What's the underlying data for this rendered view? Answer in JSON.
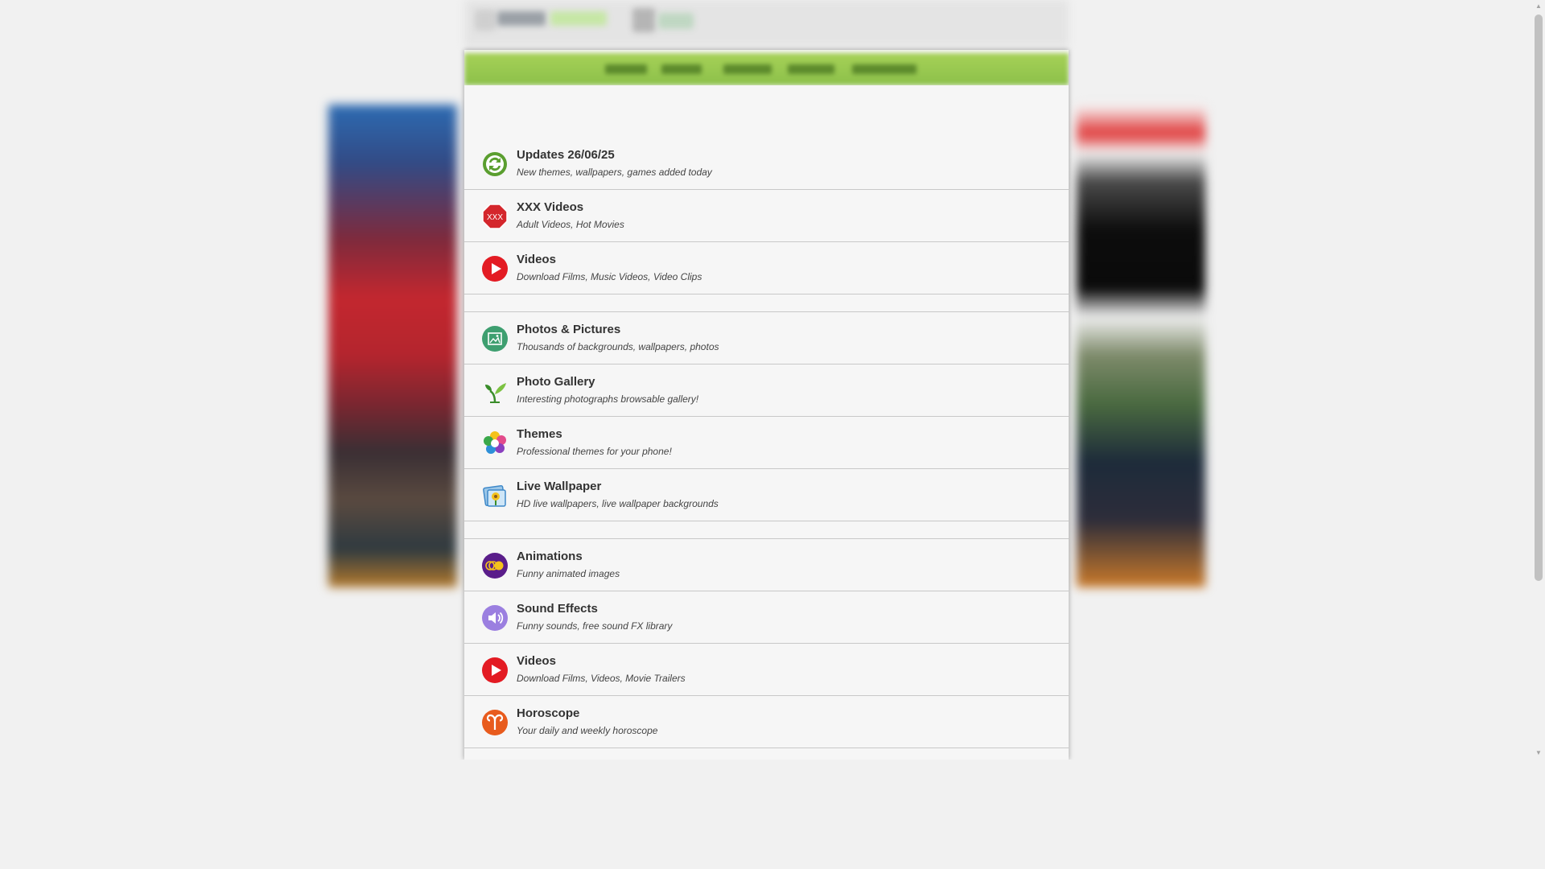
{
  "page": {
    "accent_color": "#8cc04a"
  },
  "menu_items": [
    {
      "label": ""
    },
    {
      "label": ""
    },
    {
      "label": ""
    },
    {
      "label": ""
    },
    {
      "label": ""
    }
  ],
  "sections": [
    {
      "items": [
        {
          "title": "Updates 26/06/25",
          "desc": "New themes, wallpapers, games added today",
          "icon": "refresh-icon",
          "color": "#5a9e2f"
        },
        {
          "title": "XXX Videos",
          "desc": "Adult Videos, Hot Movies",
          "icon": "xxx-stop-icon",
          "color": "#d4262c"
        },
        {
          "title": "Videos",
          "desc": "Download Films, Music Videos, Video Clips",
          "icon": "play-icon",
          "color": "#e31b23"
        }
      ]
    },
    {
      "items": [
        {
          "title": "Photos & Pictures",
          "desc": "Thousands of backgrounds, wallpapers, photos",
          "icon": "picture-icon",
          "color": "#3e9f70"
        },
        {
          "title": "Photo Gallery",
          "desc": "Interesting photographs browsable gallery!",
          "icon": "sprout-icon",
          "color": "#3a8d2a"
        },
        {
          "title": "Themes",
          "desc": "Professional themes for your phone!",
          "icon": "flower-icon",
          "color": "#e34b8b"
        },
        {
          "title": "Live Wallpaper",
          "desc": "HD live wallpapers, live wallpaper backgrounds",
          "icon": "sunflower-picture-icon",
          "color": "#3f89c9"
        }
      ]
    },
    {
      "items": [
        {
          "title": "Animations",
          "desc": "Funny animated images",
          "icon": "animation-icon",
          "color": "#5a1d8a"
        },
        {
          "title": "Sound Effects",
          "desc": "Funny sounds, free sound FX library",
          "icon": "speaker-icon",
          "color": "#9b7fe0"
        },
        {
          "title": "Videos",
          "desc": "Download Films, Videos, Movie Trailers",
          "icon": "play-icon",
          "color": "#e31b23"
        },
        {
          "title": "Horoscope",
          "desc": "Your daily and weekly horoscope",
          "icon": "aries-icon",
          "color": "#e85b1d"
        }
      ]
    }
  ]
}
